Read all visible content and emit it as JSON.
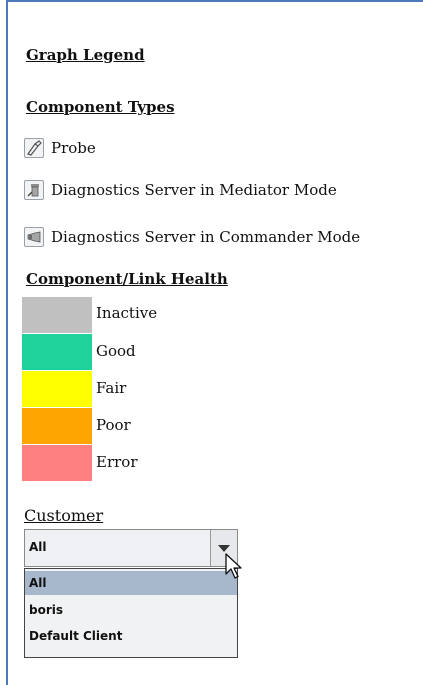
{
  "legend": {
    "title": "Graph Legend",
    "component_types_heading": "Component Types",
    "component_types": [
      {
        "label": "Probe",
        "icon": "probe-icon"
      },
      {
        "label": "Diagnostics Server in Mediator Mode",
        "icon": "mediator-server-icon"
      },
      {
        "label": "Diagnostics Server in Commander Mode",
        "icon": "commander-server-icon"
      }
    ],
    "health_heading": "Component/Link Health",
    "health": [
      {
        "label": "Inactive",
        "color": "#c0c0c0"
      },
      {
        "label": "Good",
        "color": "#1fd19a"
      },
      {
        "label": "Fair",
        "color": "#ffff00"
      },
      {
        "label": "Poor",
        "color": "#ffa500"
      },
      {
        "label": "Error",
        "color": "#ff8080"
      }
    ]
  },
  "customer": {
    "label": "Customer",
    "selected": "All",
    "options": [
      "All",
      "boris",
      "Default Client"
    ]
  }
}
